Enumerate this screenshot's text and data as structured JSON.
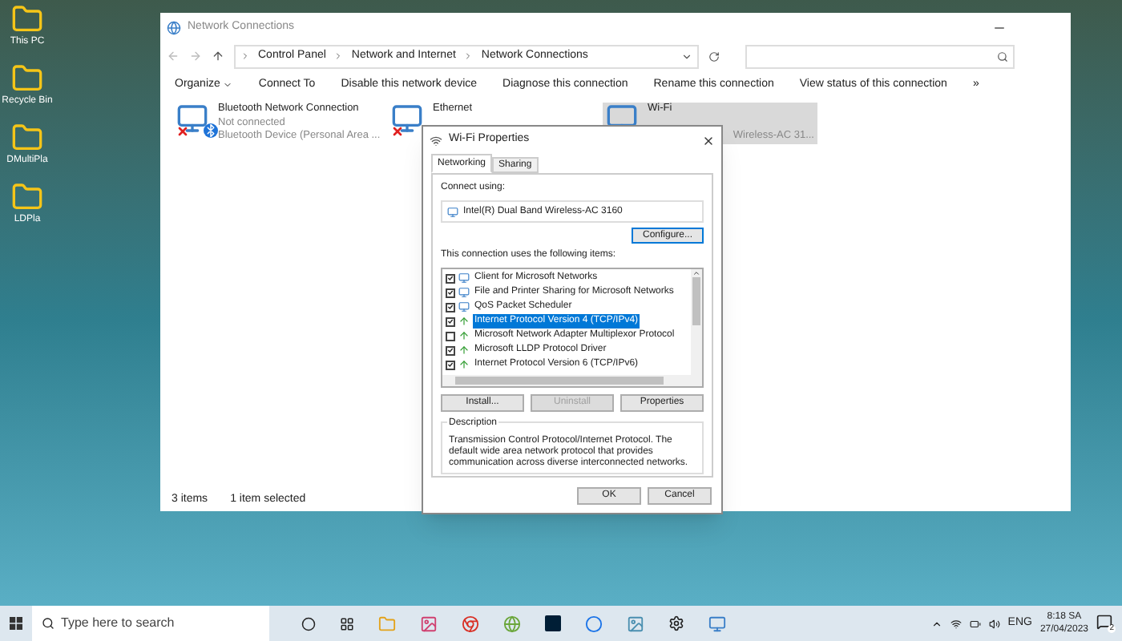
{
  "desktop": {
    "icons": [
      {
        "label": "This PC"
      },
      {
        "label": "Recycle Bin"
      },
      {
        "label": "DMultiPla"
      },
      {
        "label": "LDPla"
      }
    ]
  },
  "explorer": {
    "title": "Network Connections",
    "breadcrumb": [
      "Control Panel",
      "Network and Internet",
      "Network Connections"
    ],
    "toolbar": [
      "Organize",
      "Connect To",
      "Disable this network device",
      "Diagnose this connection",
      "Rename this connection",
      "View status of this connection",
      "»"
    ],
    "connections": [
      {
        "name": "Bluetooth Network Connection",
        "status": "Not connected",
        "device": "Bluetooth Device (Personal Area ...",
        "kind": "bluetooth",
        "disconnected": true,
        "selected": false
      },
      {
        "name": "Ethernet",
        "kind": "ethernet",
        "disconnected": true,
        "selected": false
      },
      {
        "name": "Wi-Fi",
        "device": "Wireless-AC 31...",
        "kind": "wifi",
        "disconnected": false,
        "selected": true
      }
    ],
    "status_bar": [
      "3 items",
      "1 item selected"
    ]
  },
  "dialog": {
    "title": "Wi-Fi Properties",
    "tabs": [
      {
        "label": "Networking",
        "selected": true
      },
      {
        "label": "Sharing",
        "selected": false
      }
    ],
    "connect_using_label": "Connect using:",
    "adapter": "Intel(R) Dual Band Wireless-AC 3160",
    "configure_button": "Configure...",
    "items_label": "This connection uses the following items:",
    "items": [
      {
        "label": "Client for Microsoft Networks",
        "checked": true,
        "selected": false,
        "kind": "client"
      },
      {
        "label": "File and Printer Sharing for Microsoft Networks",
        "checked": true,
        "selected": false,
        "kind": "client"
      },
      {
        "label": "QoS Packet Scheduler",
        "checked": true,
        "selected": false,
        "kind": "client"
      },
      {
        "label": "Internet Protocol Version 4 (TCP/IPv4)",
        "checked": true,
        "selected": true,
        "kind": "protocol"
      },
      {
        "label": "Microsoft Network Adapter Multiplexor Protocol",
        "checked": false,
        "selected": false,
        "kind": "protocol"
      },
      {
        "label": "Microsoft LLDP Protocol Driver",
        "checked": true,
        "selected": false,
        "kind": "protocol"
      },
      {
        "label": "Internet Protocol Version 6 (TCP/IPv6)",
        "checked": true,
        "selected": false,
        "kind": "protocol"
      }
    ],
    "buttons": [
      {
        "label": "Install...",
        "disabled": false
      },
      {
        "label": "Uninstall",
        "disabled": true
      },
      {
        "label": "Properties",
        "disabled": false
      }
    ],
    "description_label": "Description",
    "description": "Transmission Control Protocol/Internet Protocol. The default wide area network protocol that provides communication across diverse interconnected networks.",
    "ok": "OK",
    "cancel": "Cancel"
  },
  "taskbar": {
    "search_placeholder": "Type here to search",
    "language": "ENG",
    "time": "8:18 SA",
    "date": "27/04/2023",
    "notifications": "2"
  }
}
